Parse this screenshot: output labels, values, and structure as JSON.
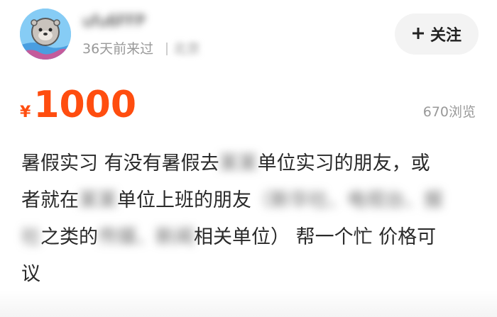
{
  "header": {
    "avatar_icon": "otter-astronaut-avatar",
    "username": "ufu6FFP",
    "last_seen": "36天前来过",
    "location": "北京"
  },
  "follow_button": {
    "icon": "plus-icon",
    "label": "关注"
  },
  "price": {
    "currency": "¥",
    "amount": "1000",
    "color": "#ff4d0f"
  },
  "views": "670浏览",
  "description": {
    "line1": {
      "a": "暑假实习  有没有暑假去",
      "blur": "某某",
      "b": "单位实习的朋友，或"
    },
    "line2": {
      "a": "者就在",
      "blur1": "某某",
      "b": "单位上班的朋友",
      "blur2": "（新华社、电视台、报"
    },
    "line3": {
      "blur1": "社",
      "a": "之类的",
      "blur2": "传媒、新闻",
      "b": "相关单位）  帮一个忙  价格可"
    },
    "line4": {
      "a": "议"
    }
  }
}
